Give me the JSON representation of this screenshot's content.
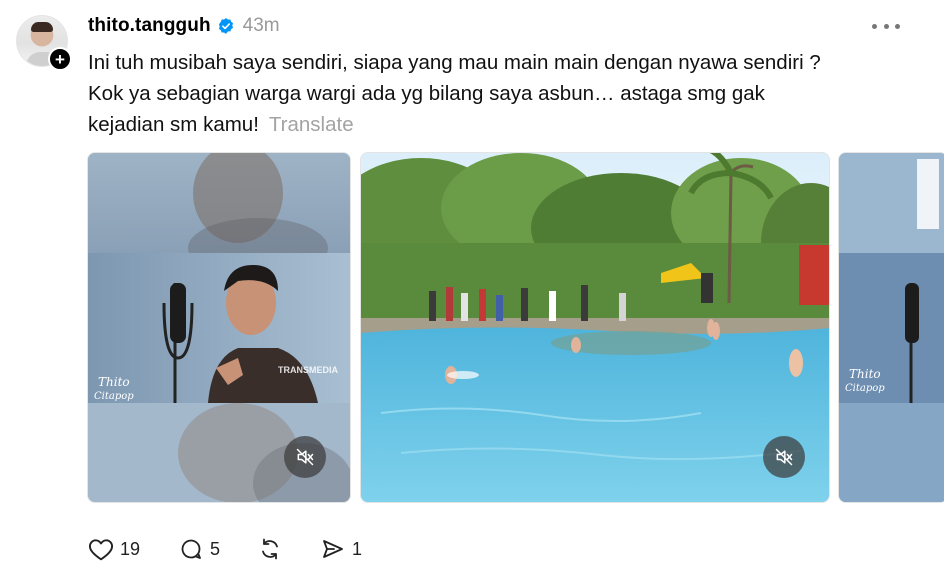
{
  "post": {
    "username": "thito.tangguh",
    "timestamp": "43m",
    "text_lines": [
      "Ini tuh musibah saya sendiri, siapa yang mau main main dengan nyawa sendiri ?",
      "Kok ya sebagian warga wargi ada yg bilang saya asbun… astaga smg gak",
      "kejadian sm kamu!"
    ],
    "translate_label": "Translate",
    "follow_badge": "+",
    "media": {
      "video1_watermark_brand": "TRANSMEDIA",
      "video1_logo": "Thito Citapop",
      "video3_logo": "Thito Citapop"
    },
    "actions": {
      "likes": "19",
      "replies": "5",
      "shares": "1"
    }
  },
  "icons": {
    "verified": "verified-badge-icon",
    "more": "more-dots-icon",
    "mute": "speaker-muted-icon",
    "like": "heart-icon",
    "reply": "comment-bubble-icon",
    "repost": "repost-icon",
    "share": "send-icon"
  },
  "colors": {
    "verified": "#0095f6",
    "muted_text": "#999999",
    "pool": "#5fc2e6"
  }
}
